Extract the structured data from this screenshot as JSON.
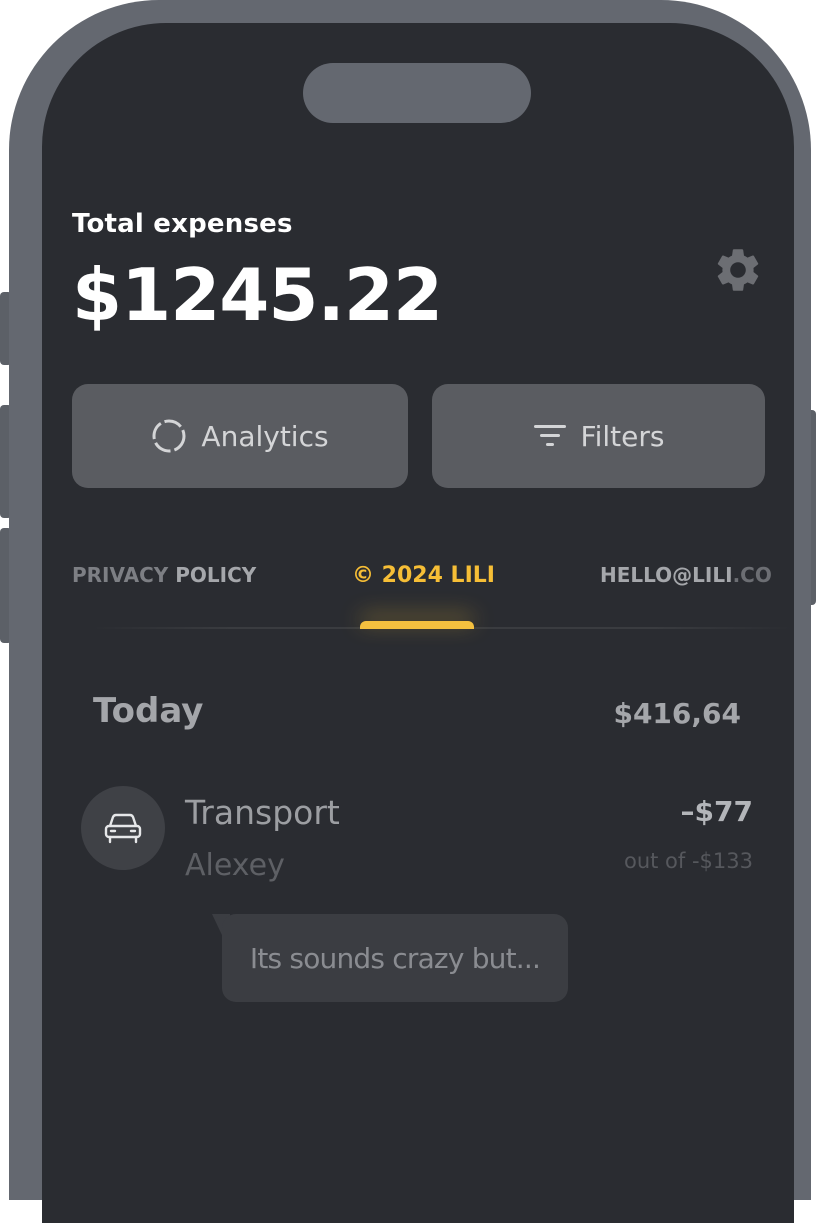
{
  "header": {
    "total_label": "Total expenses",
    "total_amount": "$1245.22"
  },
  "actions": {
    "analytics_label": "Analytics",
    "filters_label": "Filters"
  },
  "tabs": {
    "privacy_dim": "PRIVACY",
    "privacy_bright": " POLICY",
    "copyright": "© 2024 LILI",
    "email_bright": "HELLO@LILI",
    "email_fade": ".CO",
    "active": "copyright"
  },
  "day": {
    "label": "Today",
    "total": "$416,64"
  },
  "transaction": {
    "icon": "car-icon",
    "title": "Transport",
    "subtitle": "Alexey",
    "amount": "–$77",
    "limit": "out of -$133"
  },
  "message": {
    "text": "Its sounds crazy but..."
  },
  "colors": {
    "background": "#2a2c31",
    "frame": "#646870",
    "accent": "#f6be36",
    "button": "#5a5c61"
  }
}
